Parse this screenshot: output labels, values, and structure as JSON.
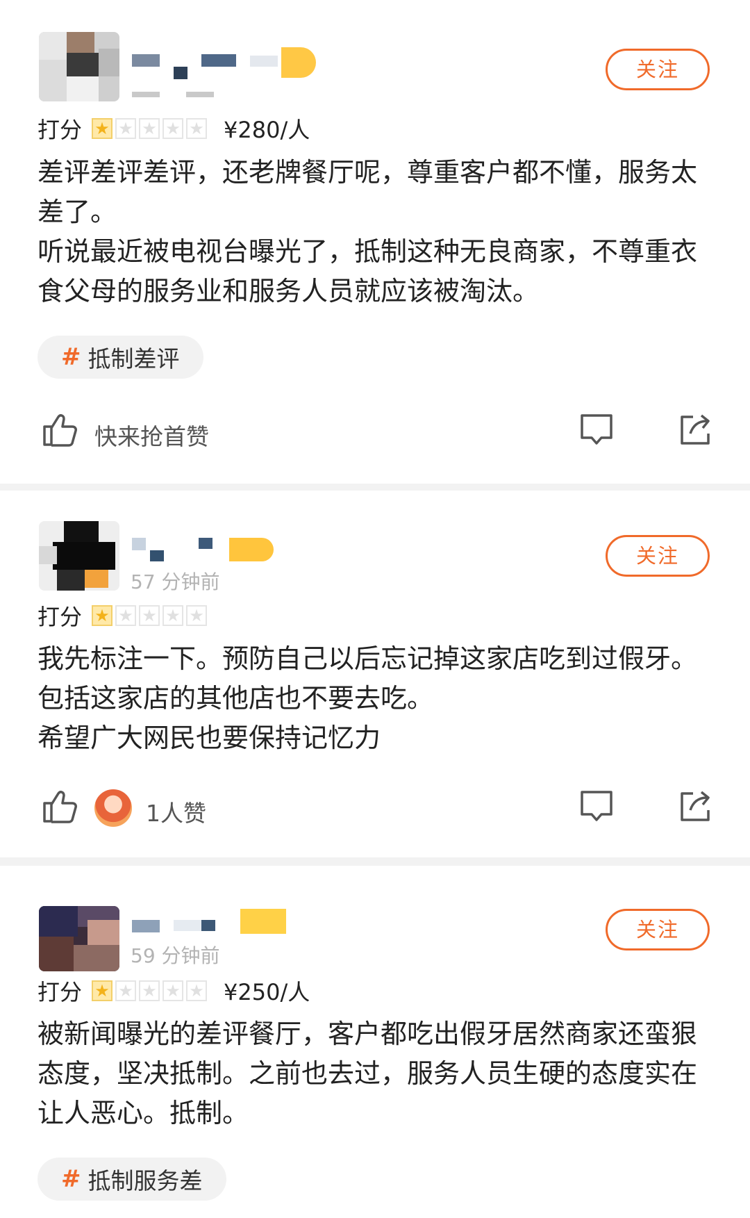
{
  "follow_label": "关注",
  "rating_label": "打分",
  "colors": {
    "accent": "#f06a2a",
    "star": "#f3b21a"
  },
  "reviews": [
    {
      "user_blurred": true,
      "time": "",
      "stars": 1,
      "max_stars": 5,
      "price": "¥280/人",
      "paragraphs": [
        "差评差评差评，还老牌餐厅呢，尊重客户都不懂，服务太差了。",
        "听说最近被电视台曝光了，抵制这种无良商家，不尊重衣食父母的服务业和服务人员就应该被淘汰。"
      ],
      "tag": "抵制差评",
      "like_text": "快来抢首赞"
    },
    {
      "user_blurred": true,
      "time": "57 分钟前",
      "stars": 1,
      "max_stars": 5,
      "price": "",
      "paragraphs": [
        "我先标注一下。预防自己以后忘记掉这家店吃到过假牙。包括这家店的其他店也不要去吃。",
        "希望广大网民也要保持记忆力"
      ],
      "tag": "",
      "like_text": "1人赞"
    },
    {
      "user_blurred": true,
      "time": "59 分钟前",
      "stars": 1,
      "max_stars": 5,
      "price": "¥250/人",
      "paragraphs": [
        "被新闻曝光的差评餐厅，客户都吃出假牙居然商家还蛮狠态度，坚决抵制。之前也去过，服务人员生硬的态度实在让人恶心。抵制。"
      ],
      "tag": "抵制服务差",
      "like_text": ""
    }
  ]
}
